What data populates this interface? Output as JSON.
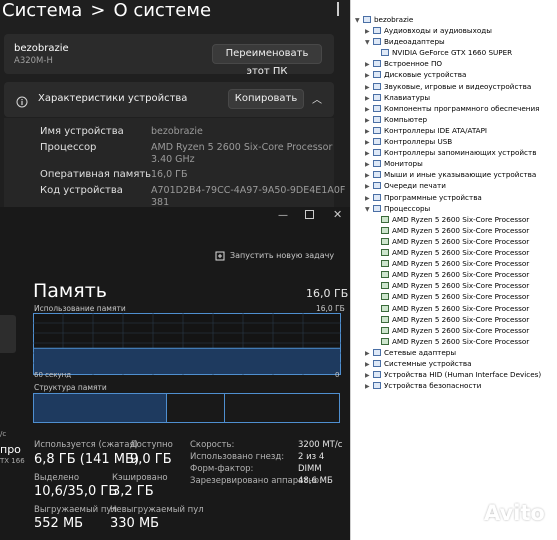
{
  "settings": {
    "breadcrumb_root": "Система",
    "breadcrumb_sep": ">",
    "breadcrumb_page": "О системе",
    "device_name": "bezobrazie",
    "device_model": "A320M-H",
    "rename_button": "Переименовать этот ПК",
    "specs_title": "Характеристики устройства",
    "copy_button": "Копировать",
    "specs": [
      {
        "label": "Имя устройства",
        "value": "bezobrazie"
      },
      {
        "label": "Процессор",
        "value": "AMD Ryzen 5 2600 Six-Core Processor",
        "value2": "3.40 GHz"
      },
      {
        "label": "Оперативная память",
        "value": "16,0 ГБ"
      },
      {
        "label": "Код устройства",
        "value": "A701D2B4-79CC-4A97-9A50-9DE4E1A0F",
        "value2": "381"
      }
    ]
  },
  "taskmgr": {
    "run_task": "Запустить новую задачу",
    "title": "Память",
    "total": "16,0 ГБ",
    "usage_label": "Использование памяти",
    "usage_max": "16,0 ГБ",
    "time_left": "60 секунд",
    "time_right": "0",
    "composition_label": "Структура памяти",
    "left_cut": [
      "пpo",
      "TX 166",
      "/c"
    ],
    "stats": {
      "in_use_label": "Используется (сжатая)",
      "in_use": "6,8 ГБ (141 МБ)",
      "available_label": "Доступно",
      "available": "9,0 ГБ",
      "committed_label": "Выделено",
      "committed": "10,6/35,0 ГБ",
      "cached_label": "Кэшировано",
      "cached": "3,2 ГБ",
      "paged_label": "Выгружаемый пул",
      "paged": "552 МБ",
      "nonpaged_label": "Невыгружаемый пул",
      "nonpaged": "330 МБ"
    },
    "right": [
      {
        "label": "Скорость:",
        "value": "3200 MT/c"
      },
      {
        "label": "Использовано гнезд:",
        "value": "2 из 4"
      },
      {
        "label": "Форм-фактор:",
        "value": "DIMM"
      },
      {
        "label": "Зарезервировано аппаратно:",
        "value": "48,6 МБ"
      }
    ],
    "usage_fraction": 0.43
  },
  "devmgr": {
    "root": "bezobrazie",
    "items": [
      {
        "label": "Аудиовходы и аудиовыходы",
        "expanded": false
      },
      {
        "label": "Видеоадаптеры",
        "expanded": true
      },
      {
        "label": "NVIDIA GeForce GTX 1660 SUPER",
        "child": true
      },
      {
        "label": "Встроенное ПО",
        "expanded": false
      },
      {
        "label": "Дисковые устройства",
        "expanded": false
      },
      {
        "label": "Звуковые, игровые и видеоустройства",
        "expanded": false
      },
      {
        "label": "Клавиатуры",
        "expanded": false
      },
      {
        "label": "Компоненты программного обеспечения",
        "expanded": false
      },
      {
        "label": "Компьютер",
        "expanded": false
      },
      {
        "label": "Контроллеры IDE ATA/ATAPI",
        "expanded": false
      },
      {
        "label": "Контроллеры USB",
        "expanded": false
      },
      {
        "label": "Контроллеры запоминающих устройств",
        "expanded": false
      },
      {
        "label": "Мониторы",
        "expanded": false
      },
      {
        "label": "Мыши и иные указывающие устройства",
        "expanded": false
      },
      {
        "label": "Очереди печати",
        "expanded": false
      },
      {
        "label": "Программные устройства",
        "expanded": false
      },
      {
        "label": "Процессоры",
        "expanded": true
      },
      {
        "label": "AMD Ryzen 5 2600 Six-Core Processor",
        "child": true,
        "cpu": true
      },
      {
        "label": "AMD Ryzen 5 2600 Six-Core Processor",
        "child": true,
        "cpu": true
      },
      {
        "label": "AMD Ryzen 5 2600 Six-Core Processor",
        "child": true,
        "cpu": true
      },
      {
        "label": "AMD Ryzen 5 2600 Six-Core Processor",
        "child": true,
        "cpu": true
      },
      {
        "label": "AMD Ryzen 5 2600 Six-Core Processor",
        "child": true,
        "cpu": true
      },
      {
        "label": "AMD Ryzen 5 2600 Six-Core Processor",
        "child": true,
        "cpu": true
      },
      {
        "label": "AMD Ryzen 5 2600 Six-Core Processor",
        "child": true,
        "cpu": true
      },
      {
        "label": "AMD Ryzen 5 2600 Six-Core Processor",
        "child": true,
        "cpu": true
      },
      {
        "label": "AMD Ryzen 5 2600 Six-Core Processor",
        "child": true,
        "cpu": true
      },
      {
        "label": "AMD Ryzen 5 2600 Six-Core Processor",
        "child": true,
        "cpu": true
      },
      {
        "label": "AMD Ryzen 5 2600 Six-Core Processor",
        "child": true,
        "cpu": true
      },
      {
        "label": "AMD Ryzen 5 2600 Six-Core Processor",
        "child": true,
        "cpu": true
      },
      {
        "label": "Сетевые адаптеры",
        "expanded": false
      },
      {
        "label": "Системные устройства",
        "expanded": false
      },
      {
        "label": "Устройства HID (Human Interface Devices)",
        "expanded": false
      },
      {
        "label": "Устройства безопасности",
        "expanded": false
      }
    ]
  },
  "watermark": "Avito",
  "colors": {
    "graph_fill": "#1e3a5f",
    "graph_line": "#4f8fd0",
    "accent": "#4f8fd0"
  }
}
